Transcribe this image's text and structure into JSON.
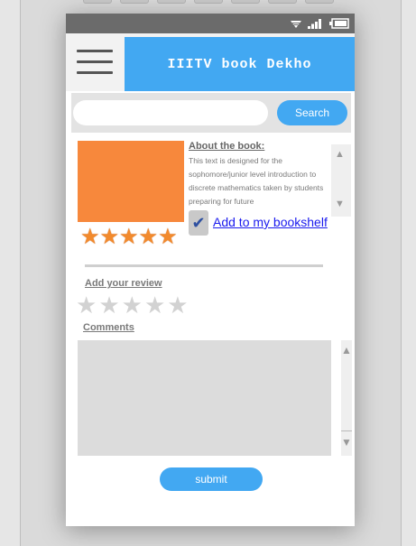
{
  "header": {
    "title": "IIITV book Dekho"
  },
  "search": {
    "placeholder": "",
    "value": "",
    "button_label": "Search"
  },
  "book": {
    "about_title": "About the book:",
    "about_text": "This text is designed for the sophomore/junior level introduction to discrete mathematics taken by students preparing for future",
    "rating": 5,
    "rating_max": 5,
    "add_to_bookshelf_label": "Add to my bookshelf",
    "bookshelf_checked": true
  },
  "review": {
    "label": "Add your review",
    "stars_selected": 0,
    "stars_max": 5
  },
  "comments": {
    "label": "Comments",
    "value": ""
  },
  "submit": {
    "label": "submit"
  },
  "colors": {
    "accent": "#42a8f2",
    "cover": "#f7883c",
    "star_filled": "#f28a2d",
    "star_empty": "#d2d2d2",
    "statusbar": "#6b6b6b"
  },
  "icons": {
    "menu": "hamburger-menu-icon",
    "wifi": "wifi-icon",
    "signal": "signal-icon",
    "battery": "battery-icon",
    "check": "checkmark-icon"
  }
}
